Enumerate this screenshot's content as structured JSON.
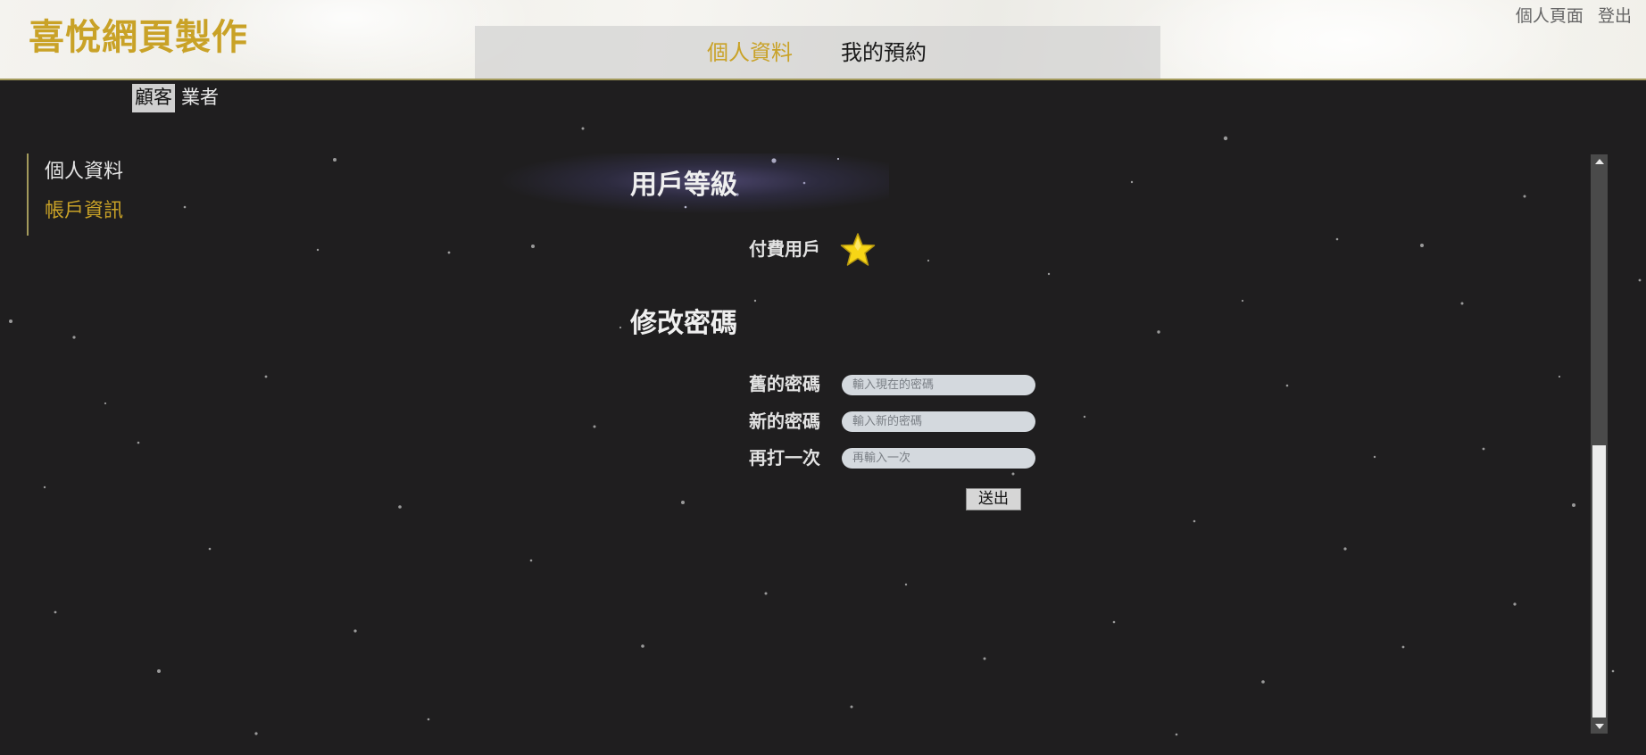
{
  "header": {
    "logo": "喜悅網頁製作",
    "nav": {
      "profile": "個人資料",
      "bookings": "我的預約"
    },
    "user_links": {
      "personal_page": "個人頁面",
      "logout": "登出"
    }
  },
  "role_tabs": {
    "customer": "顧客",
    "vendor": "業者",
    "selected": "顧客"
  },
  "side_menu": {
    "items": [
      {
        "label": "個人資料",
        "active": false
      },
      {
        "label": "帳戶資訊",
        "active": true
      }
    ]
  },
  "user_level": {
    "title": "用戶等級",
    "label": "付費用戶",
    "icon": "star-icon"
  },
  "change_password": {
    "title": "修改密碼",
    "old_password": {
      "label": "舊的密碼",
      "placeholder": "輸入現在的密碼",
      "value": ""
    },
    "new_password": {
      "label": "新的密碼",
      "placeholder": "輸入新的密碼",
      "value": ""
    },
    "confirm_password": {
      "label": "再打一次",
      "placeholder": "再輸入一次",
      "value": ""
    },
    "submit_label": "送出"
  },
  "colors": {
    "accent": "#c9a227",
    "background": "#1f1e1f",
    "input_bg": "#d4d9de",
    "star": "#f7d516"
  }
}
